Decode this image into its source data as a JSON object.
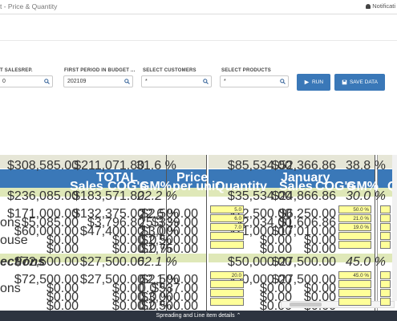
{
  "app": {
    "title": "t - Price & Quantity",
    "notifications": "Notificati"
  },
  "filters": [
    {
      "label": "T SALESREP.",
      "value": "0"
    },
    {
      "label": "FIRST PERIOD IN BUDGET ...",
      "value": "202109"
    },
    {
      "label": "SELECT CUSTOMERS",
      "value": "*"
    },
    {
      "label": "SELECT PRODUCTS",
      "value": "*"
    }
  ],
  "buttons": {
    "run": "RUN",
    "save": "SAVE DATA"
  },
  "totals_row": {
    "sales": "$308,585.00",
    "cogs": "$211,071.80",
    "gm": "31.6 %",
    "jan_sales": "$85,534.00",
    "jan_cogs": "$52,366.86",
    "jan_gm": "38.8 %"
  },
  "headers": {
    "total": "TOTAL",
    "sales": "Sales",
    "cogs": "COG's",
    "gm": "GM%",
    "price1": "Price",
    "price2": "per unit",
    "january": "January",
    "quantity": "Quantity",
    "jan_sales": "Sales",
    "jan_cogs": "COG's",
    "jan_gm": "GM%",
    "next_qty": "Qu"
  },
  "group1": {
    "sales": "$236,085.00",
    "cogs": "$183,571.80",
    "gm": "22.2 %",
    "jan_sales": "$35,534.00",
    "jan_cogs": "$24,866.86",
    "jan_gm": "30.0 %"
  },
  "rows1": [
    {
      "label": "",
      "sales": "$171,000.00",
      "cogs": "$132,375.00",
      "gm": "22.6 %",
      "price": "$2,500.00",
      "qty": "5.0",
      "jsales": "$12,500.00",
      "jcogs": "$6,250.00",
      "jgm": "50.0 %"
    },
    {
      "label": "ons",
      "sales": "$5,085.00",
      "cogs": "$3,796.80",
      "gm": "25.3 %",
      "price": "$339.00",
      "qty": "6.0",
      "jsales": "$2,034.00",
      "jcogs": "$1,606.86",
      "jgm": "21.0 %"
    },
    {
      "label": "",
      "sales": "$60,000.00",
      "cogs": "$47,400.00",
      "gm": "21.0 %",
      "price": "$3,000.00",
      "qty": "7.0",
      "jsales": "$21,000.00",
      "jcogs": "$17,010.00",
      "jgm": "19.0 %"
    },
    {
      "label": "ouse",
      "sales": "$0.00",
      "cogs": "$0.00",
      "gm": "0.0 %",
      "price": "$2,500.00",
      "qty": "",
      "jsales": "$0.00",
      "jcogs": "$0.00",
      "jgm": ""
    },
    {
      "label": "",
      "sales": "$0.00",
      "cogs": "$0.00",
      "gm": "0.0 %",
      "price": "$2,750.00",
      "qty": "",
      "jsales": "$0.00",
      "jcogs": "$0.00",
      "jgm": ""
    }
  ],
  "group2": {
    "label": "ections",
    "sales": "$72,500.00",
    "cogs": "$27,500.00",
    "gm": "62.1 %",
    "jan_sales": "$50,000.00",
    "jan_cogs": "$27,500.00",
    "jan_gm": "45.0 %"
  },
  "rows2": [
    {
      "label": "",
      "sales": "$72,500.00",
      "cogs": "$27,500.00",
      "gm": "62.1 %",
      "price": "$2,500.00",
      "qty": "20.0",
      "jsales": "$50,000.00",
      "jcogs": "$27,500.00",
      "jgm": "45.0 %"
    },
    {
      "label": "ons",
      "sales": "$0.00",
      "cogs": "$0.00",
      "gm": "0.0 %",
      "price": "$537.00",
      "qty": "",
      "jsales": "$0.00",
      "jcogs": "$0.00",
      "jgm": ""
    },
    {
      "label": "",
      "sales": "$0.00",
      "cogs": "$0.00",
      "gm": "0.0 %",
      "price": "$3,000.00",
      "qty": "",
      "jsales": "$0.00",
      "jcogs": "$0.00",
      "jgm": ""
    },
    {
      "label": "",
      "sales": "$0.00",
      "cogs": "$0.00",
      "gm": "0.0 %",
      "price": "$2,500.00",
      "qty": "",
      "jsales": "$0.00",
      "jcogs": "$0.00",
      "jgm": ""
    }
  ],
  "footer": {
    "label": "Spreading and Line item details"
  }
}
